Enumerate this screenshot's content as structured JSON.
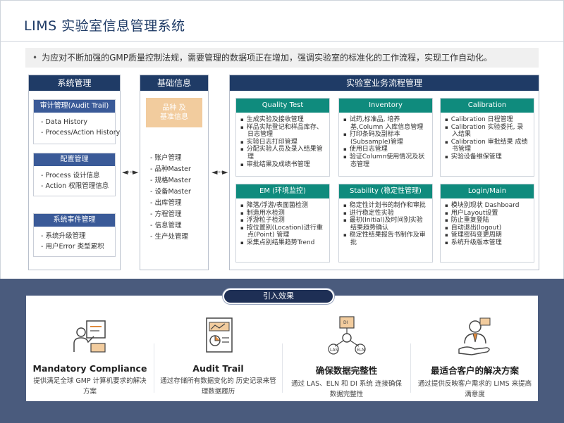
{
  "page": {
    "title": "LIMS 实验室信息管理系统",
    "intro": "为应对不断加强的GMP质量控制法规，需要管理的数据项正在增加，强调实验室的标准化的工作流程，实现工作自动化。"
  },
  "system_mgmt": {
    "header": "系统管理",
    "audit": {
      "title": "审计管理(Audit Trail)",
      "items": [
        "- Data History",
        "- Process/Action History"
      ]
    },
    "config": {
      "title": "配置管理",
      "items": [
        "- Process 设计信息",
        "- Action 权限管理信息"
      ]
    },
    "events": {
      "title": "系统事件管理",
      "items": [
        "- 系统升级管理",
        "- 用户Error 类型累积"
      ]
    }
  },
  "basic_info": {
    "header": "基础信息",
    "badge": "品种 及\n基准信息",
    "items": [
      "- 账户管理",
      "- 品种Master",
      "- 规格Master",
      "- 设备Master",
      "- 出库管理",
      "- 方程管理",
      "- 信息管理",
      "- 生产处管理"
    ]
  },
  "arrows": {
    "left": "◄···►",
    "right": "◄···►"
  },
  "workflow": {
    "header": "实验室业务流程管理",
    "boxes": [
      {
        "title": "Quality Test",
        "items": [
          "生成实验及接收管理",
          "样品实际登记和样品库存、日志管理",
          "实验日志打印管理",
          "分配实验人员及录入结果管理",
          "审批结果及成绩书管理"
        ]
      },
      {
        "title": "Inventory",
        "items": [
          "试药,标准品, 培养基,Column 入库信息管理",
          "打印条码及副标本(Subsample)管理",
          "使用日志管理",
          "验证Column使用情况及状态管理"
        ]
      },
      {
        "title": "Calibration",
        "items": [
          "Calibration 日程管理",
          "Calibration 实验委托, 录入结果",
          "Calibration 审批结果 成绩书管理",
          "实验设备维保管理"
        ]
      },
      {
        "title": "EM (环境监控)",
        "items": [
          "降落/浮游/表面菌检测",
          "制造用水检测",
          "浮游粒子检测",
          "按位置别(Location)进行重点(Point) 管理",
          "采集点别结果趋势Trend"
        ]
      },
      {
        "title": "Stability (稳定性管理)",
        "items": [
          "稳定性计划书的制作和审批",
          "进行稳定性实验",
          "最初(Initial)及时间别实验结果趋势确认",
          "稳定性结果报告书制作及审批"
        ]
      },
      {
        "title": "Login/Main",
        "items": [
          "模块别现状 Dashboard",
          "用户Layout设置",
          "防止重复登陆",
          "自动退出(logout)",
          "管理密码变更周期",
          "系统升级版本管理"
        ]
      }
    ]
  },
  "effects": {
    "pill": "引入效果",
    "cards": [
      {
        "title": "Mandatory Compliance",
        "desc": "提供满足全球 GMP 计算机要求的解决方案",
        "icon": "compliance-presenter-icon"
      },
      {
        "title": "Audit Trail",
        "desc": "通过存储所有数据变化的 历史记录来管理数据履历",
        "icon": "audit-document-icon"
      },
      {
        "title": "确保数据完整性",
        "desc": "通过 LAS、ELN 和 DI 系统 连接确保数据完整性",
        "icon": "data-integrity-network-icon"
      },
      {
        "title": "最适合客户的解决方案",
        "desc": "通过提供反映客户需求的 LIMS 来提高满意度",
        "icon": "customer-solution-icon"
      }
    ],
    "icon_labels": {
      "las": "LAS",
      "eln": "ELN",
      "di": "DI"
    }
  },
  "colors": {
    "navy": "#1f3b66",
    "teal": "#0f8b7d",
    "band": "#4a5b7d",
    "orange": "#f2cc9e"
  }
}
